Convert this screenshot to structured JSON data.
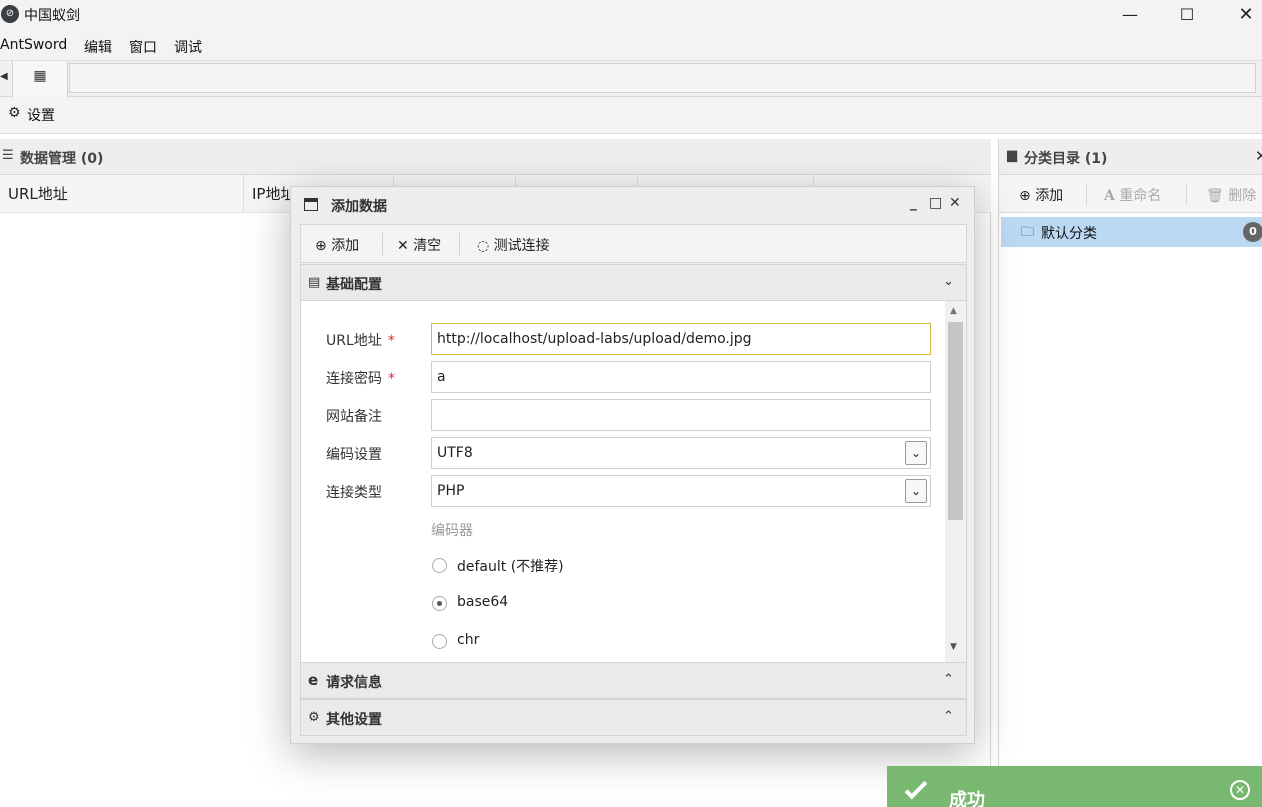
{
  "window": {
    "title": "中国蚁剑",
    "minimize_glyph": "—",
    "maximize_glyph": "☐",
    "close_glyph": "✕"
  },
  "menu": {
    "items": [
      "AntSword",
      "编辑",
      "窗口",
      "调试"
    ]
  },
  "settings_bar": {
    "label": "设置"
  },
  "data_panel": {
    "title": "数据管理 (0)",
    "columns": [
      "URL地址",
      "IP地址"
    ]
  },
  "category_panel": {
    "title": "分类目录 (1)",
    "toolbar": {
      "add": "添加",
      "rename": "重命名",
      "delete": "删除"
    },
    "items": [
      {
        "label": "默认分类",
        "count": "0"
      }
    ]
  },
  "dialog": {
    "title": "添加数据",
    "toolbar": {
      "add": "添加",
      "clear": "清空",
      "test": "测试连接"
    },
    "sections": {
      "basic": "基础配置",
      "request": "请求信息",
      "other": "其他设置"
    },
    "form": {
      "url_label": "URL地址",
      "url_value": "http://localhost/upload-labs/upload/demo.jpg",
      "password_label": "连接密码",
      "password_value": "a",
      "note_label": "网站备注",
      "note_value": "",
      "encoding_label": "编码设置",
      "encoding_value": "UTF8",
      "type_label": "连接类型",
      "type_value": "PHP",
      "required_mark": "*",
      "encoder_title": "编码器",
      "encoders": [
        "default (不推荐)",
        "base64",
        "chr"
      ],
      "selected_encoder": "base64"
    }
  },
  "toast": {
    "text": "成功"
  },
  "icons": {
    "app": "antsword-logo-icon",
    "settings": "gear-icon",
    "grid": "grid-icon",
    "list": "list-icon",
    "folder": "folder-icon",
    "plus": "plus-circle-icon",
    "times": "times-icon",
    "spinner": "spinner-icon",
    "file": "file-icon",
    "ie": "ie-icon",
    "cogs": "cogs-icon"
  },
  "colors": {
    "selected_row": "#bcd9f4",
    "toast_bg": "#79b871",
    "required": "#e23333",
    "focus_border": "#d8b94a"
  }
}
